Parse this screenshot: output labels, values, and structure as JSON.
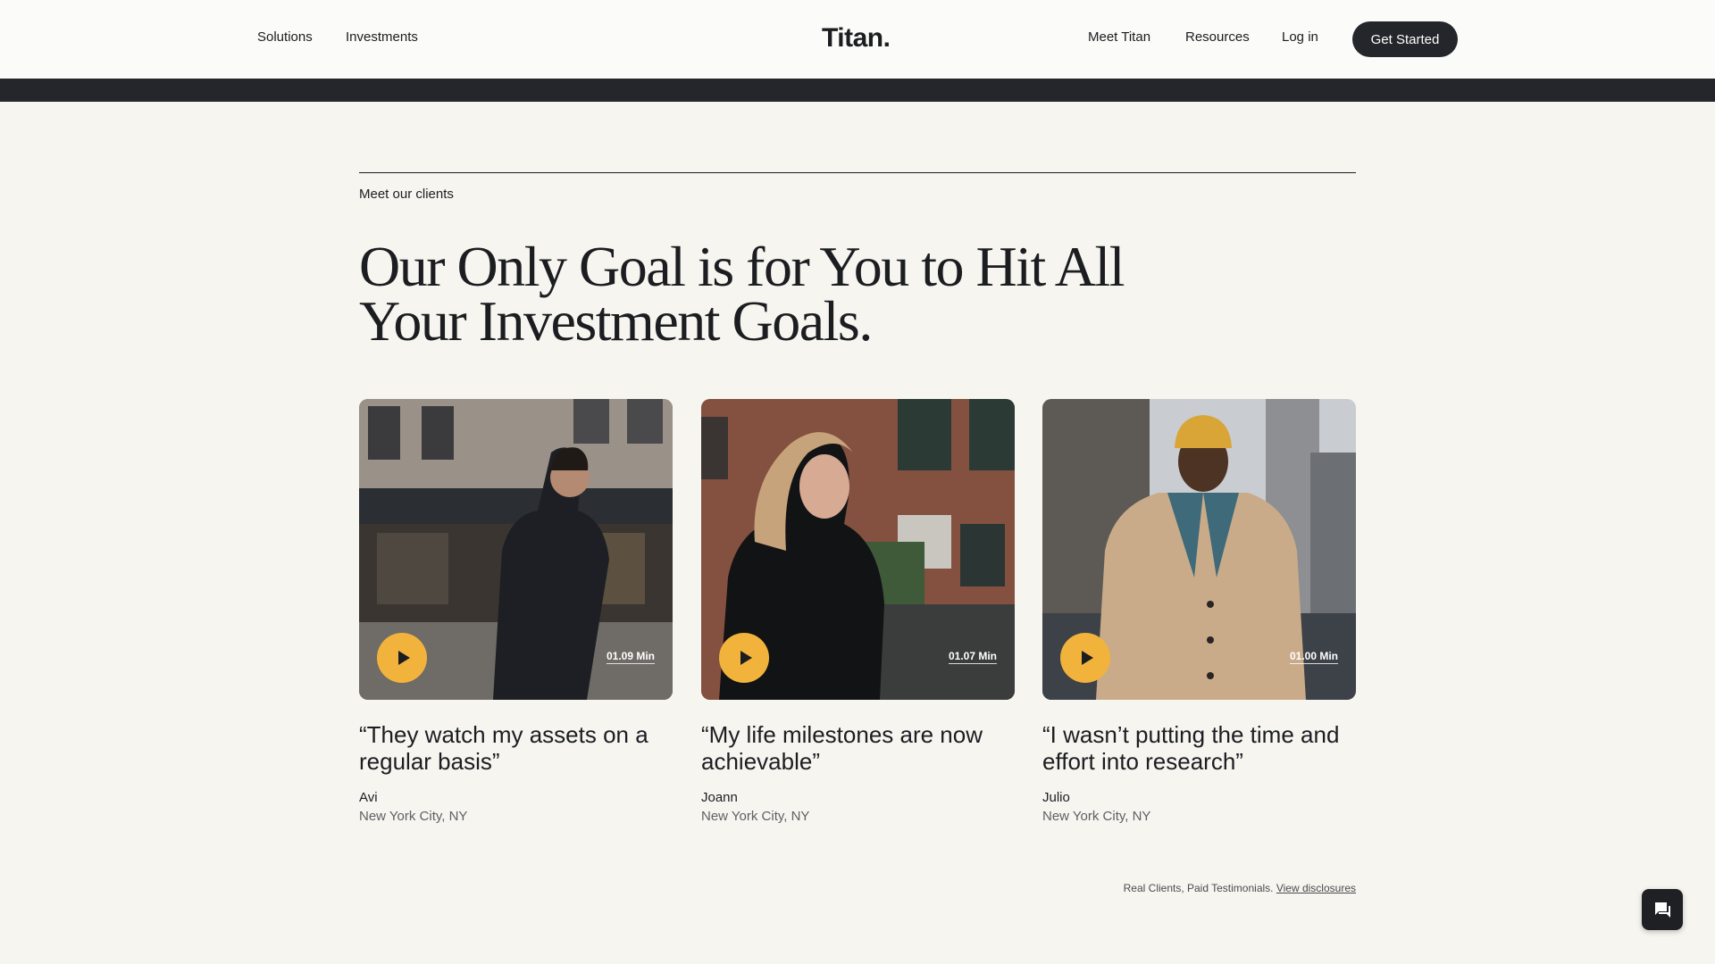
{
  "nav": {
    "solutions": "Solutions",
    "investments": "Investments",
    "logo": "Titan.",
    "meet_titan": "Meet Titan",
    "resources": "Resources",
    "login": "Log in",
    "cta": "Get Started"
  },
  "section": {
    "eyebrow": "Meet our clients",
    "headline": "Our Only Goal is for You to Hit All Your Investment Goals."
  },
  "testimonials": [
    {
      "duration": "01.09 Min",
      "quote": "“They watch my assets on a regular basis”",
      "name": "Avi",
      "location": "New York City, NY"
    },
    {
      "duration": "01.07 Min",
      "quote": "“My life milestones are now achievable”",
      "name": "Joann",
      "location": "New York City, NY"
    },
    {
      "duration": "01.00 Min",
      "quote": "“I wasn’t putting the time and effort into research”",
      "name": "Julio",
      "location": "New York City, NY"
    }
  ],
  "footer": {
    "disclaimer": "Real Clients, Paid Testimonials.",
    "disclosures_link": "View disclosures"
  },
  "colors": {
    "background": "#f6f5f0",
    "dark": "#25262b",
    "accent_play": "#f2b33c"
  },
  "icons": {
    "play": "play-icon",
    "chat": "chat-icon"
  }
}
